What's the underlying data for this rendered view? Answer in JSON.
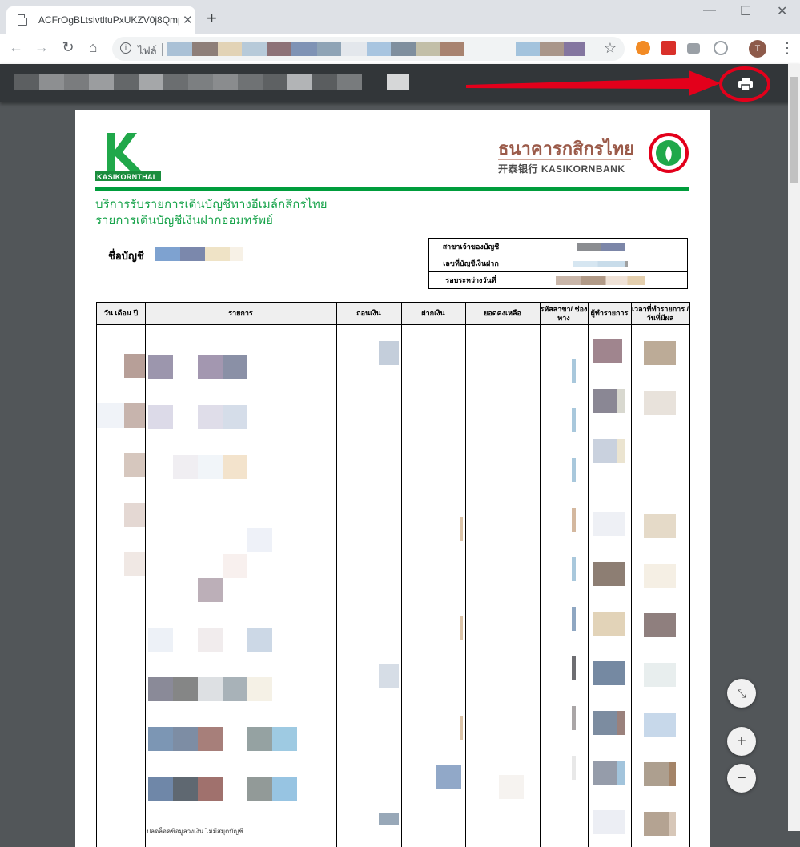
{
  "browser": {
    "tab_title": "ACFrOgBLtslvtltuPxUKZV0j8Qmp",
    "tab_close": "✕",
    "new_tab": "+",
    "omnibox_label": "ไฟล์",
    "avatar_letter": "T",
    "window_controls": {
      "minimize": "—",
      "maximize": "☐",
      "close": "✕"
    }
  },
  "nav": {
    "back": "←",
    "forward": "→",
    "reload": "↻",
    "home": "⌂",
    "star": "☆",
    "menu": "⋮"
  },
  "pdf_toolbar": {
    "print_icon": "printer-icon"
  },
  "document": {
    "bank_name_th": "ธนาคารกสิกรไทย",
    "bank_name_en": "开泰银行 KASIKORNBANK",
    "logo_text": "KASIKORNTHAI",
    "service_line1": "บริการรับรายการเดินบัญชีทางอีเมล์กสิกรไทย",
    "service_line2": "รายการเดินบัญชีเงินฝากออมทรัพย์",
    "account_name_label": "ชื่อบัญชี",
    "info_rows": [
      {
        "label": "สาขาเจ้าของบัญชี"
      },
      {
        "label": "เลขที่บัญชีเงินฝาก"
      },
      {
        "label": "รอบระหว่างวันที่"
      }
    ],
    "table_headers": [
      "วัน เดือน ปี",
      "รายการ",
      "ถอนเงิน",
      "ฝากเงิน",
      "ยอดคงเหลือ",
      "รหัสสาขา/ ช่องทาง",
      "ผู้ทำรายการ",
      "เวลาที่ทำรายการ / วันที่มีผล"
    ],
    "footer_partial": "ปลดล็อคข้อมูลวงเงิน ไม่มีสมุดบัญชี"
  },
  "zoom_controls": {
    "fit": "⤡",
    "zoom_in": "+",
    "zoom_out": "−"
  }
}
